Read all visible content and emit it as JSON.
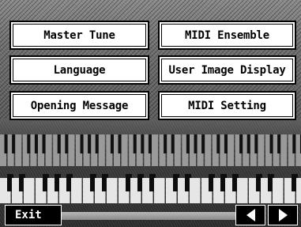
{
  "menu": {
    "left": [
      {
        "label": "Master Tune"
      },
      {
        "label": "Language"
      },
      {
        "label": "Opening Message"
      }
    ],
    "right": [
      {
        "label": "MIDI Ensemble"
      },
      {
        "label": "User Image Display"
      },
      {
        "label": "MIDI Setting"
      }
    ]
  },
  "footer": {
    "exit_label": "Exit",
    "prev_icon": "left-arrow-icon",
    "next_icon": "right-arrow-icon"
  },
  "colors": {
    "button_bg": "#ffffff",
    "button_border": "#000000",
    "footer_bg": "#000000"
  }
}
